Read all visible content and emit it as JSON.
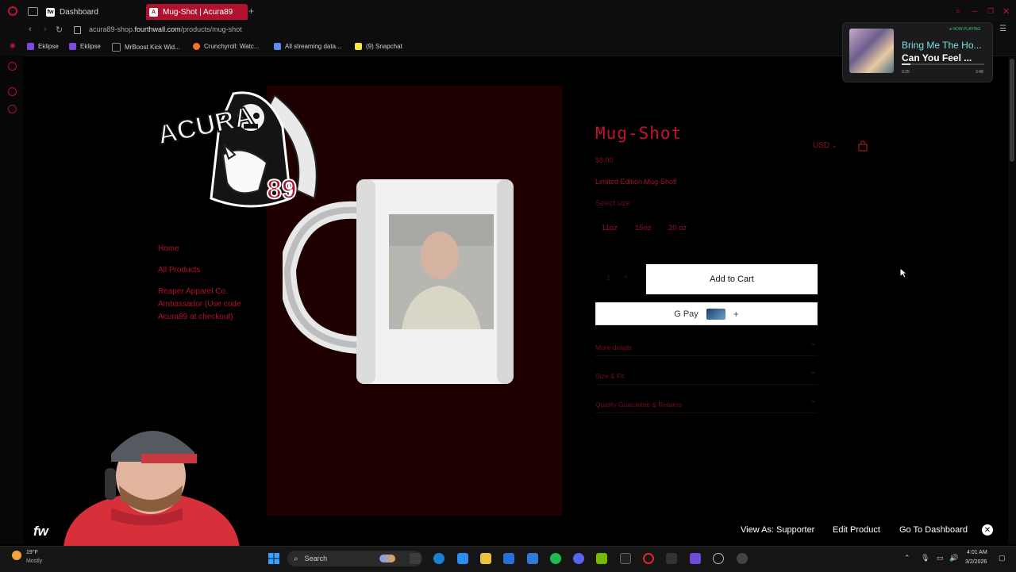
{
  "browser": {
    "tabs": [
      {
        "label": "Dashboard",
        "favicon": "fw"
      },
      {
        "label": "Mug-Shot | Acura89",
        "favicon": "A"
      }
    ],
    "url_host_prefix": "acura89-shop.",
    "url_host_main": "fourthwall.com",
    "url_path": "/products/mug-shot",
    "bookmarks": [
      {
        "label": "Eklipse",
        "color": "#7b4cd9"
      },
      {
        "label": "Eklipse",
        "color": "#7b4cd9"
      },
      {
        "label": "MrBoost Kick Wid...",
        "color": "#888888"
      },
      {
        "label": "Crunchyroll: Watc...",
        "color": "#f47521"
      },
      {
        "label": "All streaming data...",
        "color": "#5b8def"
      },
      {
        "label": "(9) Snapchat",
        "color": "#f7e64a"
      }
    ]
  },
  "store": {
    "nav": [
      {
        "label": "Home"
      },
      {
        "label": "All Products"
      },
      {
        "label": "Reaper Apparel Co. Ambassador (Use code Acura89 at checkout)"
      }
    ],
    "logo_text": "ACURA 89",
    "currency": "USD",
    "accent_color": "#c41230"
  },
  "product": {
    "title": "Mug-Shot",
    "price": "$8.00",
    "description": "Limited Edition Mug-Shot!",
    "size_label": "Select size",
    "sizes": [
      "11oz",
      "15oz",
      "20 oz"
    ],
    "quantity": "1",
    "add_to_cart": "Add to Cart",
    "gpay_label": "G Pay",
    "gpay_plus": "+",
    "accordions": [
      {
        "label": "More details"
      },
      {
        "label": "Size & Fit"
      },
      {
        "label": "Quality Guarantee & Returns"
      }
    ]
  },
  "now_playing": {
    "badge": "● NOW PLAYING",
    "title": "Bring Me The Ho...",
    "artist": "Can You Feel ...",
    "current": "0:25",
    "duration": "3:48",
    "progress": 0.11
  },
  "admin_bar": {
    "logo": "fw",
    "view_as": "View As: Supporter",
    "edit_product": "Edit Product",
    "go_dashboard": "Go To Dashboard",
    "close": "✕"
  },
  "taskbar": {
    "weather_temp": "19°F",
    "weather_desc": "Mostly",
    "search": "Search",
    "time": "4:01 AM",
    "date": "3/2/2026"
  }
}
